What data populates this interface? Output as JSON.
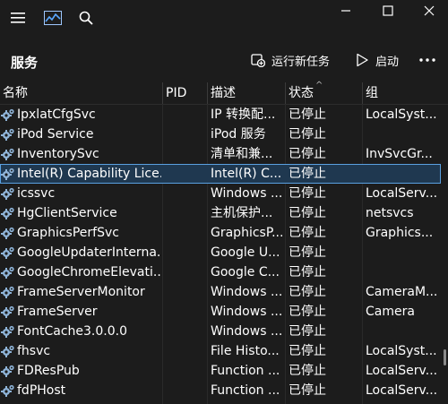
{
  "window": {
    "icons": [
      "hamburger-icon",
      "performance-graph-icon",
      "search-icon"
    ],
    "controls": [
      "minimize-icon",
      "maximize-icon",
      "close-icon"
    ]
  },
  "toolbar": {
    "title": "服务",
    "new_task_label": "运行新任务",
    "start_label": "启动",
    "more_icon": "more-icon"
  },
  "columns": {
    "name": "名称",
    "pid": "PID",
    "description": "描述",
    "status": "状态",
    "group": "组",
    "sort_indicator": "^"
  },
  "services": [
    {
      "name": "IpxlatCfgSvc",
      "pid": "",
      "description": "IP 转换配...",
      "status": "已停止",
      "group": "LocalSyst...",
      "selected": false
    },
    {
      "name": "iPod Service",
      "pid": "",
      "description": "iPod 服务",
      "status": "已停止",
      "group": "",
      "selected": false
    },
    {
      "name": "InventorySvc",
      "pid": "",
      "description": "清单和兼...",
      "status": "已停止",
      "group": "InvSvcGr...",
      "selected": false
    },
    {
      "name": "Intel(R) Capability Lice...",
      "pid": "",
      "description": "Intel(R) C...",
      "status": "已停止",
      "group": "",
      "selected": true
    },
    {
      "name": "icssvc",
      "pid": "",
      "description": "Windows ...",
      "status": "已停止",
      "group": "LocalServ...",
      "selected": false
    },
    {
      "name": "HgClientService",
      "pid": "",
      "description": "主机保护...",
      "status": "已停止",
      "group": "netsvcs",
      "selected": false
    },
    {
      "name": "GraphicsPerfSvc",
      "pid": "",
      "description": "GraphicsP...",
      "status": "已停止",
      "group": "Graphics...",
      "selected": false
    },
    {
      "name": "GoogleUpdaterInterna...",
      "pid": "",
      "description": "Google U...",
      "status": "已停止",
      "group": "",
      "selected": false
    },
    {
      "name": "GoogleChromeElevati...",
      "pid": "",
      "description": "Google C...",
      "status": "已停止",
      "group": "",
      "selected": false
    },
    {
      "name": "FrameServerMonitor",
      "pid": "",
      "description": "Windows ...",
      "status": "已停止",
      "group": "CameraM...",
      "selected": false
    },
    {
      "name": "FrameServer",
      "pid": "",
      "description": "Windows ...",
      "status": "已停止",
      "group": "Camera",
      "selected": false
    },
    {
      "name": "FontCache3.0.0.0",
      "pid": "",
      "description": "Windows ...",
      "status": "已停止",
      "group": "",
      "selected": false
    },
    {
      "name": "fhsvc",
      "pid": "",
      "description": "File Histo...",
      "status": "已停止",
      "group": "LocalSyst...",
      "selected": false
    },
    {
      "name": "FDResPub",
      "pid": "",
      "description": "Function ...",
      "status": "已停止",
      "group": "LocalServ...",
      "selected": false
    },
    {
      "name": "fdPHost",
      "pid": "",
      "description": "Function ...",
      "status": "已停止",
      "group": "LocalServ...",
      "selected": false
    }
  ],
  "colors": {
    "background": "#1c1c1c",
    "selected_row": "#1f3850",
    "selected_outline": "#5aa0e0",
    "gear": "#8fb4d8"
  }
}
